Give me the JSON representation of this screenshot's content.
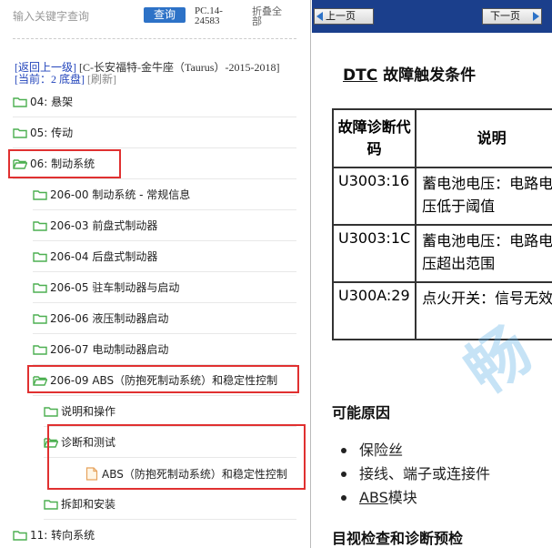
{
  "search": {
    "placeholder": "输入关键字查询",
    "button_label": "查询",
    "code_line1": "PC.14-",
    "code_line2": "24583",
    "fold_all_line1": "折叠全",
    "fold_all_line2": "部"
  },
  "breadcrumb": {
    "back_label": "[返回上一级]",
    "vehicle": "[C-长安福特-金牛座（Taurus）-2015-2018]",
    "current_label": "[当前：2 底盘]",
    "refresh_label": "[刷新]"
  },
  "tree": {
    "items": [
      {
        "label": "04: 悬架"
      },
      {
        "label": "05: 传动"
      },
      {
        "label": "06: 制动系统"
      },
      {
        "label": "206-00 制动系统 - 常规信息"
      },
      {
        "label": "206-03 前盘式制动器"
      },
      {
        "label": "206-04 后盘式制动器"
      },
      {
        "label": "206-05 驻车制动器与启动"
      },
      {
        "label": "206-06 液压制动器启动"
      },
      {
        "label": "206-07 电动制动器启动"
      },
      {
        "label": "206-09 ABS（防抱死制动系统）和稳定性控制"
      },
      {
        "label": "说明和操作"
      },
      {
        "label": "诊断和测试"
      },
      {
        "label": "ABS（防抱死制动系统）和稳定性控制"
      },
      {
        "label": "拆卸和安装"
      },
      {
        "label": "11: 转向系统"
      }
    ]
  },
  "viewer": {
    "prev_label": "上一页",
    "next_label": "下一页",
    "section_title_prefix": "DTC",
    "section_title_rest": " 故障触发条件",
    "table": {
      "headers": [
        "故障诊断代码",
        "说明"
      ],
      "rows": [
        {
          "code": "U3003:16",
          "desc_line1": "蓄电池电压：电路电",
          "desc_line2": "压低于阈值"
        },
        {
          "code": "U3003:1C",
          "desc_line1": "蓄电池电压：电路电",
          "desc_line2": "压超出范围"
        },
        {
          "code": "U300A:29",
          "desc_line1": "点火开关：信号无效",
          "desc_line2": ""
        }
      ]
    },
    "causes_title": "可能原因",
    "causes": [
      "保险丝",
      "接线、端子或连接件"
    ],
    "cause_abs_prefix": "ABS",
    "cause_abs_rest": "模块",
    "next_section_title": "目视检查和诊断预检",
    "watermark": "畅"
  },
  "colors": {
    "accent_blue": "#2d72c7",
    "topbar_navy": "#1b3f8c",
    "highlight_red": "#e03030",
    "folder_green": "#4caf50"
  }
}
